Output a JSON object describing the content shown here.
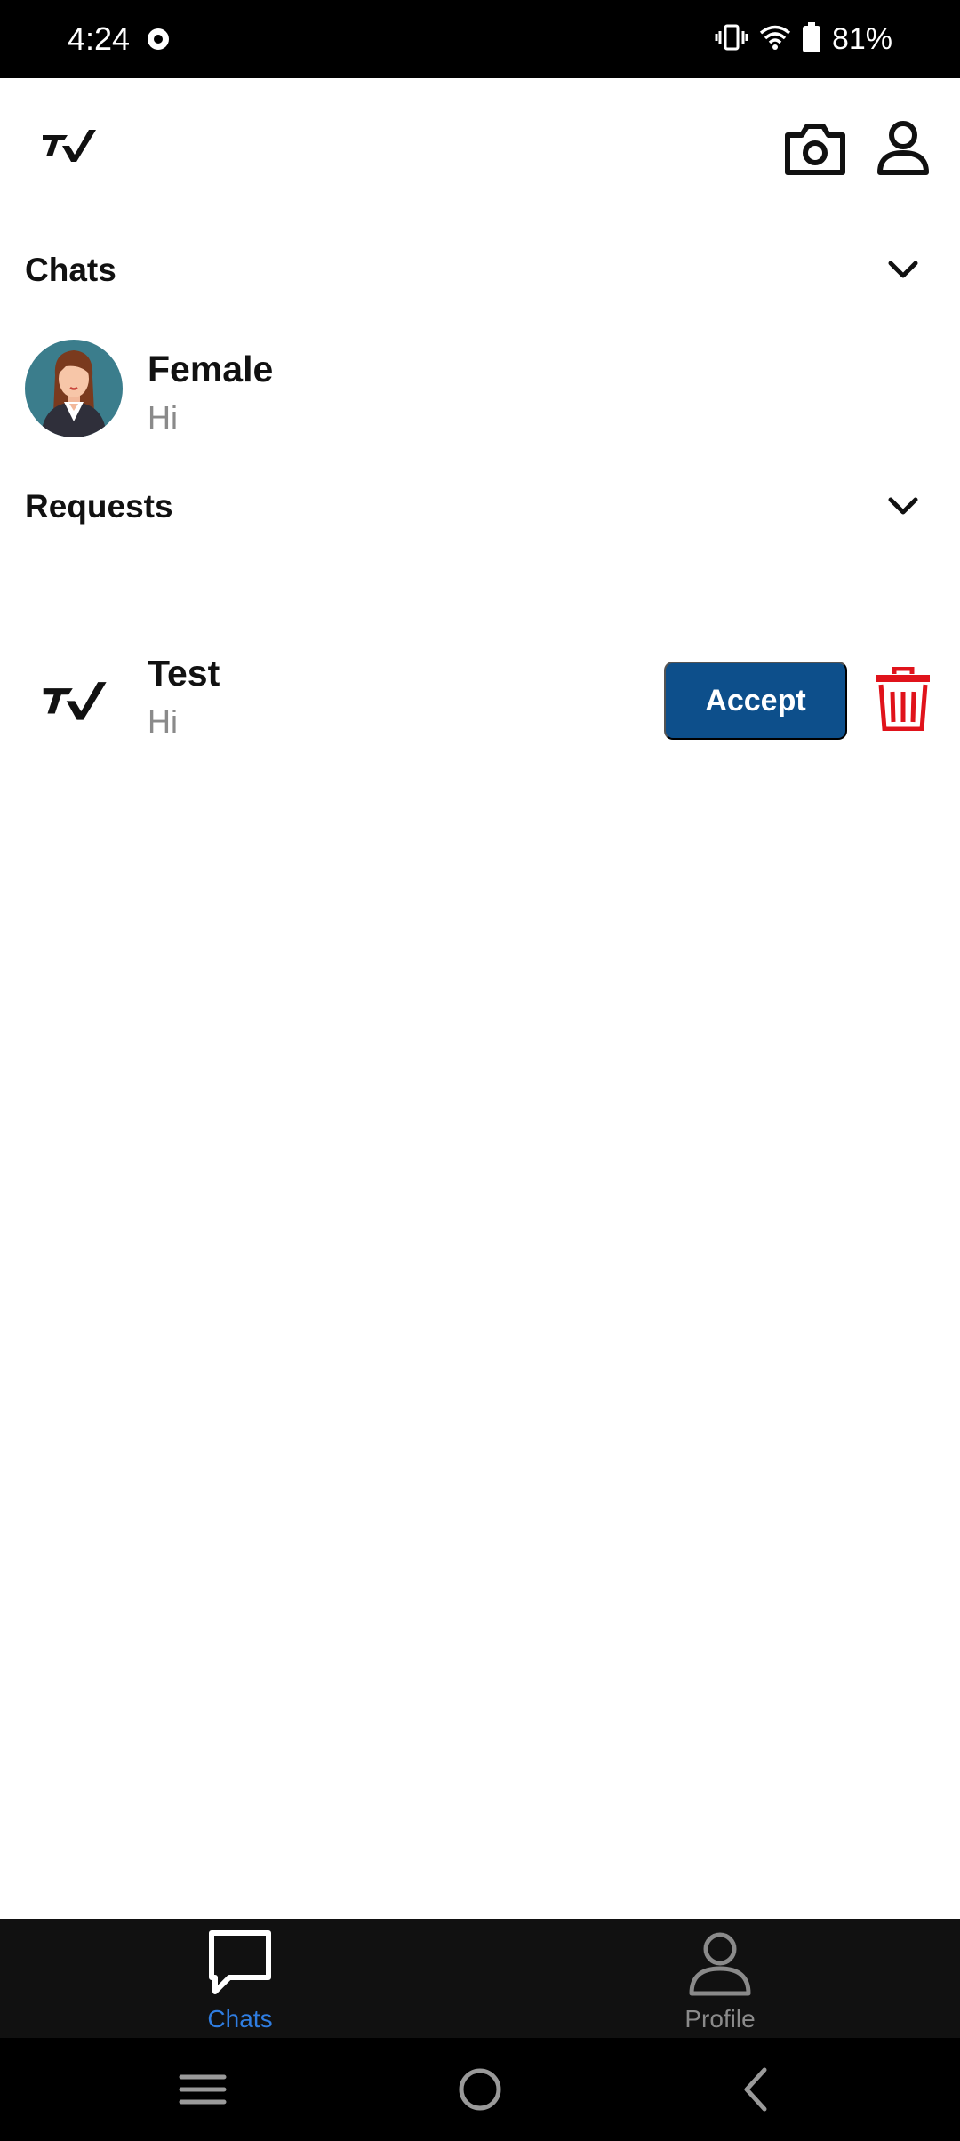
{
  "status_bar": {
    "time": "4:24",
    "battery_percent": "81%",
    "icons": [
      "app-notification-icon",
      "vibrate-icon",
      "wifi-icon",
      "battery-icon"
    ]
  },
  "header": {
    "logo": "tv-logo-icon",
    "actions": [
      "camera-icon",
      "profile-icon"
    ]
  },
  "chats_section": {
    "title": "Chats",
    "items": [
      {
        "name": "Female",
        "last_message": "Hi",
        "avatar": "female-avatar"
      }
    ]
  },
  "requests_section": {
    "title": "Requests",
    "items": [
      {
        "name": "Test",
        "last_message": "Hi",
        "avatar": "tv-logo-icon",
        "accept_label": "Accept"
      }
    ]
  },
  "bottom_nav": {
    "tabs": [
      {
        "label": "Chats",
        "icon": "chat-bubble-icon",
        "active": true
      },
      {
        "label": "Profile",
        "icon": "profile-icon",
        "active": false
      }
    ]
  },
  "colors": {
    "accent": "#2f7de1",
    "accept_button": "#0d4f8b",
    "delete": "#e0131b",
    "nav_background": "#111111",
    "inactive": "#8a8a8a"
  }
}
